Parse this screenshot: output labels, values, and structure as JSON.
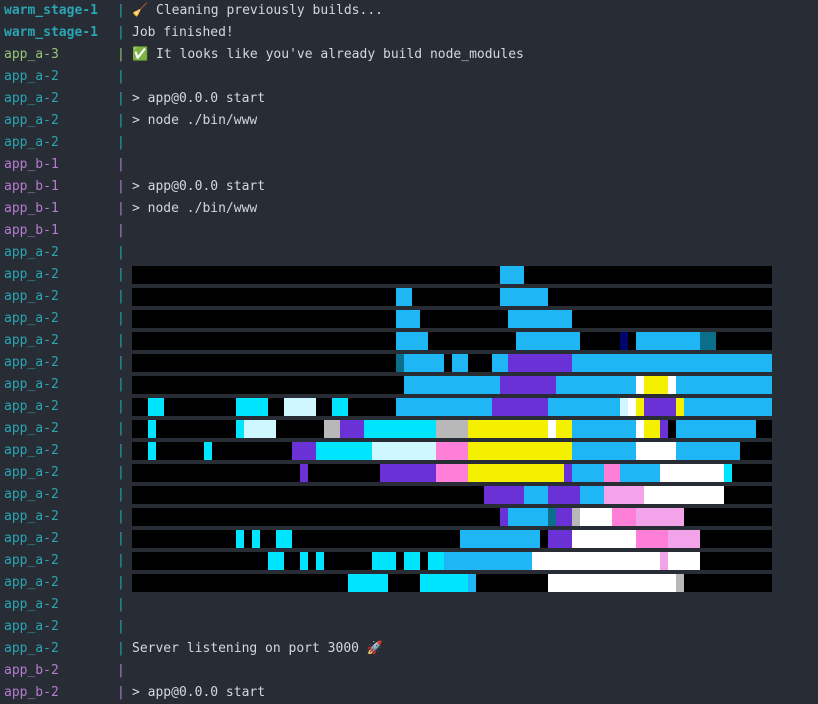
{
  "colors": {
    "background": "#282c34",
    "warm_stage": "#2aa5b3",
    "app_a_3": "#98c379",
    "app_a_2": "#2aa5b3",
    "app_b": "#b57ccf",
    "text": "#d4d7dc"
  },
  "lines": [
    {
      "prefix": "warm_stage-1",
      "color": "warm_stage",
      "bold": true,
      "text": "🧹 Cleaning previously builds..."
    },
    {
      "prefix": "warm_stage-1",
      "color": "warm_stage",
      "bold": true,
      "text": "Job finished!"
    },
    {
      "prefix": "app_a-3",
      "color": "app_a_3",
      "bold": false,
      "text": "✅ It looks like you've already build node_modules"
    },
    {
      "prefix": "app_a-2",
      "color": "app_a_2",
      "bold": false,
      "text": ""
    },
    {
      "prefix": "app_a-2",
      "color": "app_a_2",
      "bold": false,
      "text": "> app@0.0.0 start"
    },
    {
      "prefix": "app_a-2",
      "color": "app_a_2",
      "bold": false,
      "text": "> node ./bin/www"
    },
    {
      "prefix": "app_a-2",
      "color": "app_a_2",
      "bold": false,
      "text": ""
    },
    {
      "prefix": "app_b-1",
      "color": "app_b",
      "bold": false,
      "text": ""
    },
    {
      "prefix": "app_b-1",
      "color": "app_b",
      "bold": false,
      "text": "> app@0.0.0 start"
    },
    {
      "prefix": "app_b-1",
      "color": "app_b",
      "bold": false,
      "text": "> node ./bin/www"
    },
    {
      "prefix": "app_b-1",
      "color": "app_b",
      "bold": false,
      "text": ""
    },
    {
      "prefix": "app_a-2",
      "color": "app_a_2",
      "bold": false,
      "text": ""
    },
    {
      "prefix": "app_a-2",
      "color": "app_a_2",
      "bold": false,
      "text": "",
      "art": 0
    },
    {
      "prefix": "app_a-2",
      "color": "app_a_2",
      "bold": false,
      "text": "",
      "art": 1
    },
    {
      "prefix": "app_a-2",
      "color": "app_a_2",
      "bold": false,
      "text": "",
      "art": 2
    },
    {
      "prefix": "app_a-2",
      "color": "app_a_2",
      "bold": false,
      "text": "",
      "art": 3
    },
    {
      "prefix": "app_a-2",
      "color": "app_a_2",
      "bold": false,
      "text": "",
      "art": 4
    },
    {
      "prefix": "app_a-2",
      "color": "app_a_2",
      "bold": false,
      "text": "",
      "art": 5
    },
    {
      "prefix": "app_a-2",
      "color": "app_a_2",
      "bold": false,
      "text": "",
      "art": 6
    },
    {
      "prefix": "app_a-2",
      "color": "app_a_2",
      "bold": false,
      "text": "",
      "art": 7
    },
    {
      "prefix": "app_a-2",
      "color": "app_a_2",
      "bold": false,
      "text": "",
      "art": 8
    },
    {
      "prefix": "app_a-2",
      "color": "app_a_2",
      "bold": false,
      "text": "",
      "art": 9
    },
    {
      "prefix": "app_a-2",
      "color": "app_a_2",
      "bold": false,
      "text": "",
      "art": 10
    },
    {
      "prefix": "app_a-2",
      "color": "app_a_2",
      "bold": false,
      "text": "",
      "art": 11
    },
    {
      "prefix": "app_a-2",
      "color": "app_a_2",
      "bold": false,
      "text": "",
      "art": 12
    },
    {
      "prefix": "app_a-2",
      "color": "app_a_2",
      "bold": false,
      "text": "",
      "art": 13
    },
    {
      "prefix": "app_a-2",
      "color": "app_a_2",
      "bold": false,
      "text": "",
      "art": 14
    },
    {
      "prefix": "app_a-2",
      "color": "app_a_2",
      "bold": false,
      "text": ""
    },
    {
      "prefix": "app_a-2",
      "color": "app_a_2",
      "bold": false,
      "text": ""
    },
    {
      "prefix": "app_a-2",
      "color": "app_a_2",
      "bold": false,
      "text": "Server listening on port 3000 🚀"
    },
    {
      "prefix": "app_b-2",
      "color": "app_b",
      "bold": false,
      "text": ""
    },
    {
      "prefix": "app_b-2",
      "color": "app_b",
      "bold": false,
      "text": "> app@0.0.0 start"
    }
  ]
}
